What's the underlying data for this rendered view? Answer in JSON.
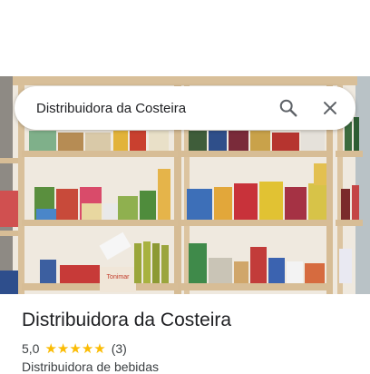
{
  "search": {
    "query": "Distribuidora da Costeira"
  },
  "place": {
    "name": "Distribuidora da Costeira",
    "rating": "5,0",
    "stars_filled": 5,
    "review_count": "(3)",
    "category": "Distribuidora de bebidas"
  },
  "photo": {
    "box_label": "Tonimar"
  },
  "colors": {
    "star": "#fbbc04",
    "text_primary": "#202124",
    "text_secondary": "#3c4043",
    "icon": "#5f6368"
  },
  "icons": [
    "search-icon",
    "close-icon",
    "star-icon"
  ]
}
